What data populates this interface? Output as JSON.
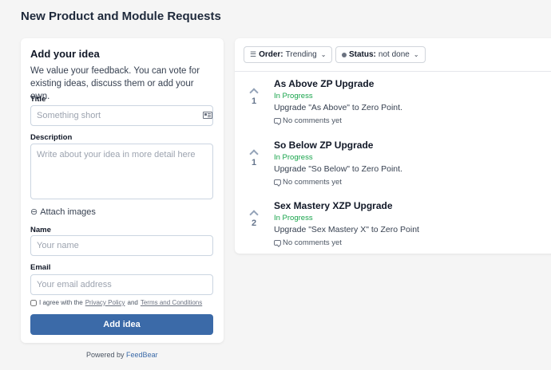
{
  "page": {
    "title": "New Product and Module Requests"
  },
  "form": {
    "heading": "Add your idea",
    "intro": "We value your feedback. You can vote for existing ideas, discuss them or add your own.",
    "title_label": "Title",
    "title_placeholder": "Something short",
    "description_label": "Description",
    "description_placeholder": "Write about your idea in more detail here",
    "attach_label": "Attach images",
    "name_label": "Name",
    "name_placeholder": "Your name",
    "email_label": "Email",
    "email_placeholder": "Your email address",
    "agree_prefix": "I agree with the",
    "privacy_link": "Privacy Policy",
    "agree_and": "and",
    "terms_link": "Terms and Conditions",
    "submit_label": "Add idea"
  },
  "footer": {
    "powered_prefix": "Powered by",
    "powered_brand": "FeedBear"
  },
  "filters": {
    "order_key": "Order:",
    "order_value": "Trending",
    "status_key": "Status:",
    "status_value": "not done"
  },
  "ideas": [
    {
      "title": "As Above ZP Upgrade",
      "status": "In Progress",
      "description": "Upgrade \"As Above\" to Zero Point.",
      "votes": "1",
      "comments": "No comments yet"
    },
    {
      "title": "So Below ZP Upgrade",
      "status": "In Progress",
      "description": "Upgrade \"So Below\" to Zero Point.",
      "votes": "1",
      "comments": "No comments yet"
    },
    {
      "title": "Sex Mastery XZP Upgrade",
      "status": "In Progress",
      "description": "Upgrade \"Sex Mastery X\" to Zero Point",
      "votes": "2",
      "comments": "No comments yet"
    }
  ],
  "colors": {
    "accent": "#3b6aa8",
    "status_in_progress": "#16a34a",
    "background": "#f5f5f5"
  },
  "icons": {
    "title_field": "id-card-icon",
    "attach": "paperclip-icon",
    "order": "sort-icon",
    "status": "status-dot-icon",
    "vote": "chevron-up-icon",
    "comments": "comment-icon"
  }
}
